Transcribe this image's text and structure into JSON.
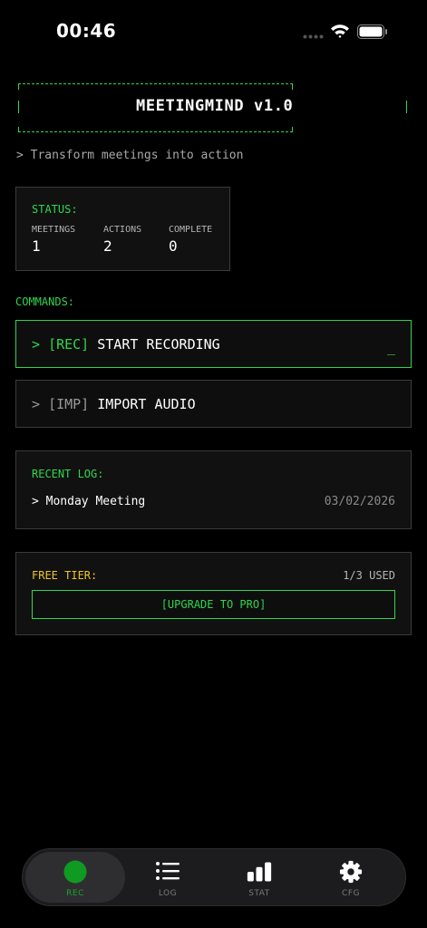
{
  "status_bar": {
    "time": "00:46"
  },
  "header": {
    "title": "MEETINGMIND v1.0",
    "tagline": "> Transform meetings into action"
  },
  "status": {
    "label": "STATUS:",
    "stats": [
      {
        "key": "MEETINGS",
        "value": "1"
      },
      {
        "key": "ACTIONS",
        "value": "2"
      },
      {
        "key": "COMPLETE",
        "value": "0"
      }
    ]
  },
  "commands": {
    "label": "COMMANDS:",
    "record": {
      "prompt": ">",
      "tag": "[REC]",
      "text": "START RECORDING",
      "cursor": "_"
    },
    "import": {
      "prompt": ">",
      "tag": "[IMP]",
      "text": "IMPORT AUDIO"
    }
  },
  "recent_log": {
    "label": "RECENT LOG:",
    "entries": [
      {
        "title": "> Monday Meeting",
        "date": "03/02/2026"
      }
    ]
  },
  "tier": {
    "label": "FREE TIER:",
    "usage": "1/3 USED",
    "upgrade_label": "[UPGRADE TO PRO]"
  },
  "tabs": [
    {
      "label": "REC",
      "icon": "record-dot-icon",
      "active": true
    },
    {
      "label": "LOG",
      "icon": "list-icon",
      "active": false
    },
    {
      "label": "STAT",
      "icon": "bar-chart-icon",
      "active": false
    },
    {
      "label": "CFG",
      "icon": "gear-icon",
      "active": false
    }
  ],
  "colors": {
    "accent": "#2fd64c",
    "warning": "#f0c42b",
    "background": "#000000",
    "card": "#111111"
  }
}
